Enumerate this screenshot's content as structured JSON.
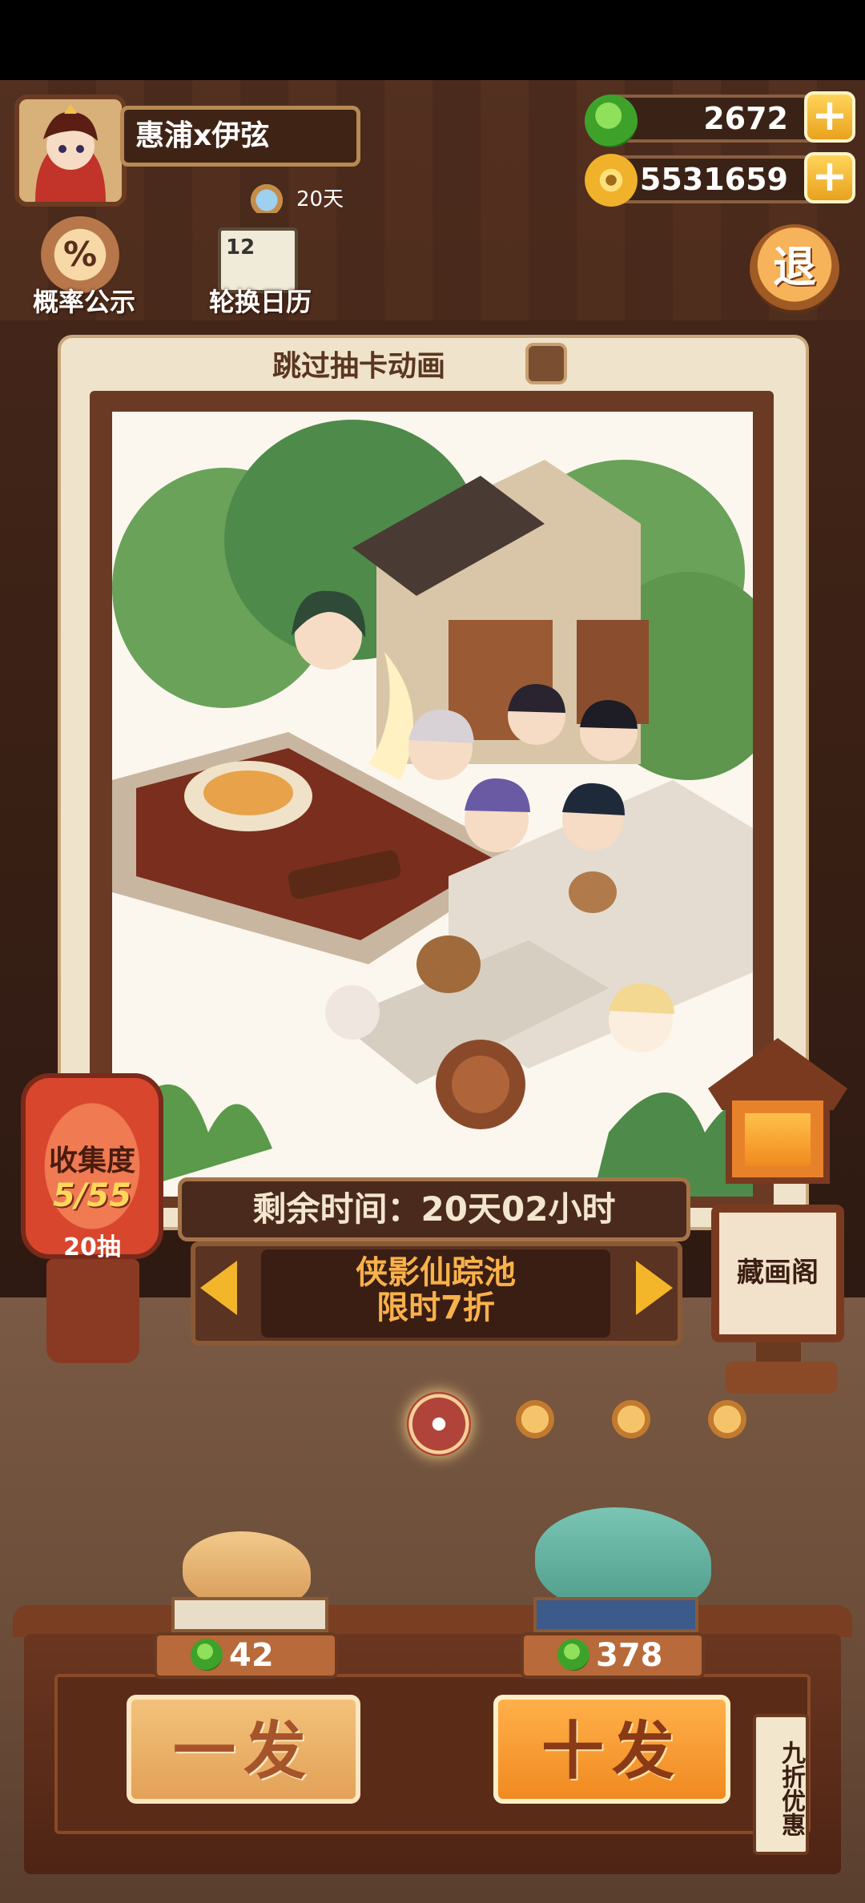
{
  "player": {
    "name": "惠浦x伊弦",
    "days": "20天"
  },
  "currency": {
    "jade": "2672",
    "gold": "5531659",
    "add_symbol": "+"
  },
  "menu": {
    "probability": "概率公示",
    "probability_symbol": "%",
    "calendar": "轮换日历",
    "calendar_number": "12",
    "exit": "退"
  },
  "card": {
    "skip_animation": "跳过抽卡动画"
  },
  "pool": {
    "timer": "剩余时间：20天02小时",
    "name": "侠影仙踪池",
    "sale": "限时7折"
  },
  "collection": {
    "title": "收集度",
    "count": "5/55",
    "pulls": "20抽"
  },
  "gallery": {
    "label": "藏画阁"
  },
  "draw": {
    "single_cost": "42",
    "ten_cost": "378",
    "single_label": "一发",
    "ten_label": "十发",
    "discount_tag_1": "九",
    "discount_tag_2": "折优惠"
  },
  "colors": {
    "accent": "#f9b14a",
    "wood": "#6b3620",
    "jade": "#3ea22a"
  }
}
